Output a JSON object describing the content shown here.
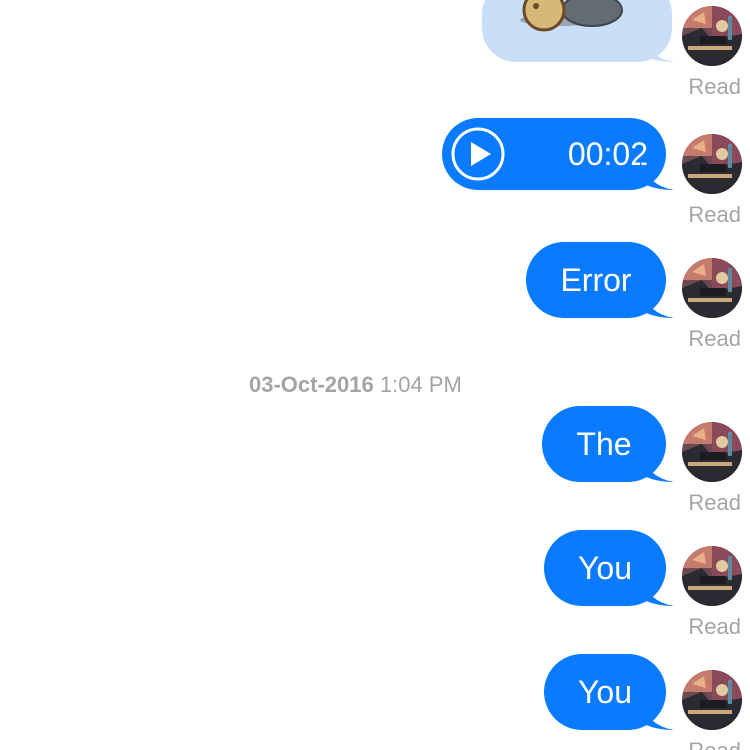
{
  "messages": [
    {
      "type": "image",
      "status": "Read"
    },
    {
      "type": "audio",
      "duration": "00:02",
      "status": "Read"
    },
    {
      "type": "text",
      "text": "Error",
      "status": "Read"
    },
    {
      "type": "text",
      "text": "The",
      "status": "Read"
    },
    {
      "type": "text",
      "text": "You",
      "status": "Read"
    },
    {
      "type": "text",
      "text": "You",
      "status": "Read"
    }
  ],
  "timestamp": {
    "date": "03-Oct-2016",
    "time": "1:04 PM"
  },
  "colors": {
    "bubble": "#0a7aff",
    "image_bubble": "#c9def7",
    "status_text": "#a4a4a8",
    "background": "#ffffff"
  },
  "icons": {
    "play": "play-circle-icon",
    "avatar": "user-avatar"
  }
}
